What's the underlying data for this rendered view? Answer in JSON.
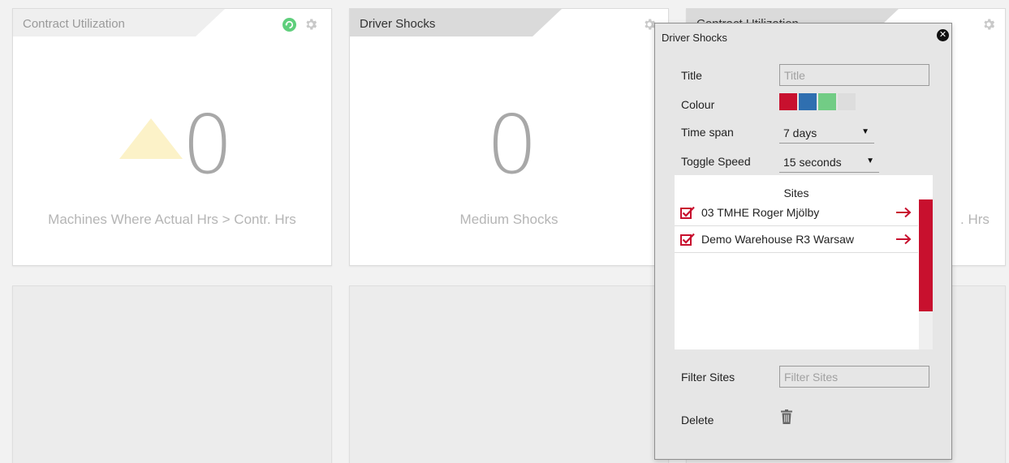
{
  "cards": {
    "card1": {
      "tab_title": "Contract Utilization",
      "value": "0",
      "caption": "Machines Where Actual Hrs > Contr. Hrs"
    },
    "card2": {
      "tab_title": "Driver Shocks",
      "value": "0",
      "caption": "Medium Shocks"
    },
    "card3": {
      "tab_title": "Contract Utilization",
      "caption_fragment": ". Hrs"
    }
  },
  "dialog": {
    "title": "Driver Shocks",
    "title_label": "Title",
    "title_placeholder": "Title",
    "colour_label": "Colour",
    "colours": [
      "#c8102e",
      "#2f6fb0",
      "#72cc85",
      "#dddddd"
    ],
    "timespan_label": "Time span",
    "timespan_value": "7 days",
    "toggle_label": "Toggle Speed",
    "toggle_value": "15 seconds",
    "sites_label": "Sites",
    "sites": [
      {
        "name": "03 TMHE Roger Mjölby"
      },
      {
        "name": "Demo Warehouse R3 Warsaw"
      }
    ],
    "filter_label": "Filter Sites",
    "filter_placeholder": "Filter Sites",
    "delete_label": "Delete"
  },
  "colors": {
    "accent_red": "#c8102e",
    "refresh_green": "#5fcf7c",
    "warning_yellow": "#fcf2c8"
  }
}
